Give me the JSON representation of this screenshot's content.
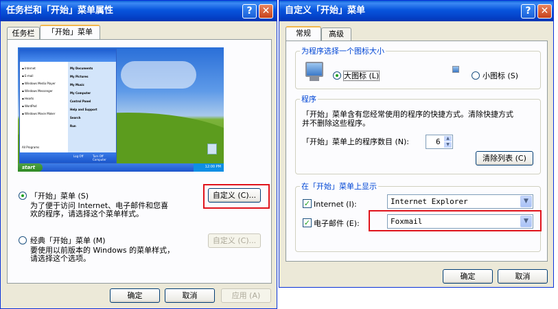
{
  "left_window": {
    "title": "任务栏和「开始」菜单属性",
    "tabs": [
      {
        "label": "任务栏"
      },
      {
        "label": "「开始」菜单"
      }
    ],
    "preview": {
      "start_label": "start",
      "menu_left": [
        "Internet",
        "E-mail",
        "Windows Media Player",
        "Windows Messenger",
        "Hearts",
        "WordPad",
        "Windows Movie Maker"
      ],
      "all_programs": "All Programs",
      "menu_right": [
        "My Documents",
        "My Pictures",
        "My Music",
        "My Computer",
        "Control Panel",
        "Help and Support",
        "Search",
        "Run"
      ],
      "logoff": "Log Off",
      "turnoff": "Turn Off Computer",
      "clock": "12:00 PM"
    },
    "option_start": {
      "label": "「开始」菜单 (S)",
      "desc1": "为了便于访问 Internet、电子邮件和您喜",
      "desc2": "欢的程序，请选择这个菜单样式。",
      "customize": "自定义 (C)..."
    },
    "option_classic": {
      "label": "经典「开始」菜单 (M)",
      "desc1": "要使用以前版本的 Windows 的菜单样式，",
      "desc2": "请选择这个选项。",
      "customize": "自定义 (C)..."
    },
    "buttons": {
      "ok": "确定",
      "cancel": "取消",
      "apply": "应用 (A)"
    }
  },
  "right_window": {
    "title": "自定义「开始」菜单",
    "tabs": [
      {
        "label": "常规"
      },
      {
        "label": "高级"
      }
    ],
    "icon_size": {
      "legend": "为程序选择一个图标大小",
      "large": "大图标 (L)",
      "small": "小图标 (S)"
    },
    "programs": {
      "legend": "程序",
      "desc1": "「开始」菜单含有您经常使用的程序的快捷方式。清除快捷方式",
      "desc2": "并不删除这些程序。",
      "count_label": "「开始」菜单上的程序数目 (N):",
      "count_value": "6",
      "clear_button": "清除列表 (C)"
    },
    "show_on_start": {
      "legend": "在「开始」菜单上显示",
      "internet_label": "Internet (I):",
      "internet_value": "Internet Explorer",
      "email_label": "电子邮件 (E):",
      "email_value": "Foxmail"
    },
    "buttons": {
      "ok": "确定",
      "cancel": "取消"
    }
  },
  "colors": {
    "titlebar": "#0855dd",
    "dialog_bg": "#ece9d8",
    "highlight_box": "#e0131b",
    "group_label": "#0046d5"
  }
}
